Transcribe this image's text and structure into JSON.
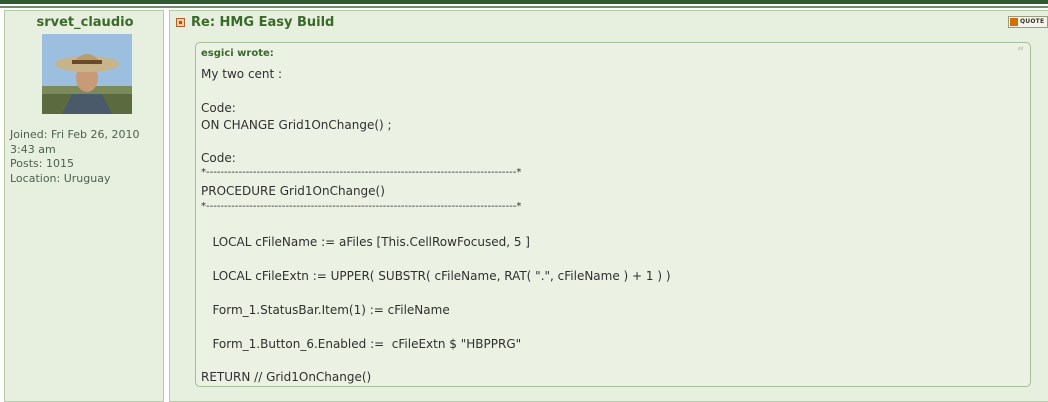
{
  "profile": {
    "username": "srvet_claudio",
    "joined": "Joined: Fri Feb 26, 2010 3:43 am",
    "joined_line1": "Joined: Fri Feb 26, 2010",
    "joined_line2": "3:43 am",
    "posts": "Posts: 1015",
    "location": "Location: Uruguay"
  },
  "post": {
    "title": "Re: HMG Easy Build",
    "quote_button": "QUOTE",
    "quote_author": "esgici wrote:",
    "quote_lines": [
      "My two cent :",
      "",
      "Code:",
      "ON CHANGE Grid1OnChange() ;",
      "",
      "Code:",
      "*--------------------------------------------------------------------------------------*",
      "PROCEDURE Grid1OnChange()",
      "*--------------------------------------------------------------------------------------*",
      "",
      "   LOCAL cFileName := aFiles [This.CellRowFocused, 5 ]",
      "",
      "   LOCAL cFileExtn := UPPER( SUBSTR( cFileName, RAT( \".\", cFileName ) + 1 ) )",
      "",
      "   Form_1.StatusBar.Item(1) := cFileName",
      "",
      "   Form_1.Button_6.Enabled :=  cFileExtn $ \"HBPPRG\"",
      "",
      "RETURN // Grid1OnChange()"
    ]
  },
  "icons": {
    "post_icon": "post-icon",
    "quote_icon": "quote-icon"
  },
  "colors": {
    "accent": "#3a6a2a",
    "panel": "#e7efdf",
    "quote_bg": "#ebf2e4"
  }
}
